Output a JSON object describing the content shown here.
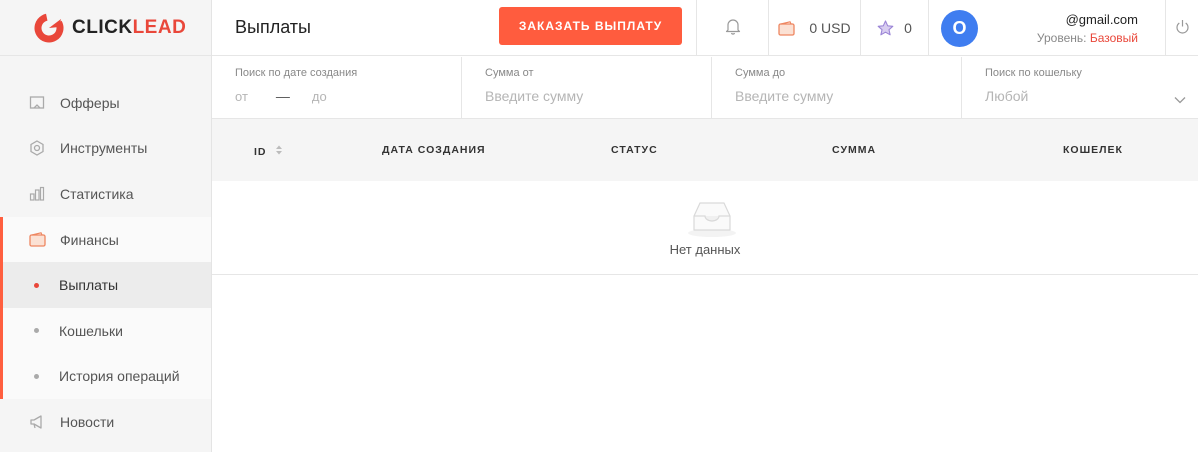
{
  "brand": {
    "name_prefix": "CLICK",
    "name_suffix": "LEAD",
    "accent": "#e9473a"
  },
  "sidebar": {
    "items": [
      {
        "label": "Офферы",
        "icon": "offers-icon"
      },
      {
        "label": "Инструменты",
        "icon": "tools-icon"
      },
      {
        "label": "Статистика",
        "icon": "statistics-icon"
      },
      {
        "label": "Финансы",
        "icon": "wallet-icon"
      },
      {
        "label": "Выплаты",
        "icon": "dot"
      },
      {
        "label": "Кошельки",
        "icon": "dot"
      },
      {
        "label": "История операций",
        "icon": "dot"
      },
      {
        "label": "Новости",
        "icon": "megaphone-icon"
      }
    ]
  },
  "header": {
    "title": "Выплаты",
    "order_button": "ЗАКАЗАТЬ ВЫПЛАТУ",
    "balance": "0 USD",
    "stars": "0",
    "user": {
      "avatar_letter": "O",
      "email": "@gmail.com",
      "level_label": "Уровень:",
      "level_value": "Базовый"
    }
  },
  "filters": {
    "date": {
      "label": "Поиск по дате создания",
      "from": "от",
      "sep": "—",
      "to": "до"
    },
    "sum_from": {
      "label": "Сумма от",
      "placeholder": "Введите сумму"
    },
    "sum_to": {
      "label": "Сумма до",
      "placeholder": "Введите сумму"
    },
    "wallet": {
      "label": "Поиск по кошельку",
      "value": "Любой"
    }
  },
  "table": {
    "columns": [
      "ID",
      "ДАТА СОЗДАНИЯ",
      "СТАТУС",
      "СУММА",
      "КОШЕЛЕК"
    ],
    "empty_text": "Нет данных"
  }
}
